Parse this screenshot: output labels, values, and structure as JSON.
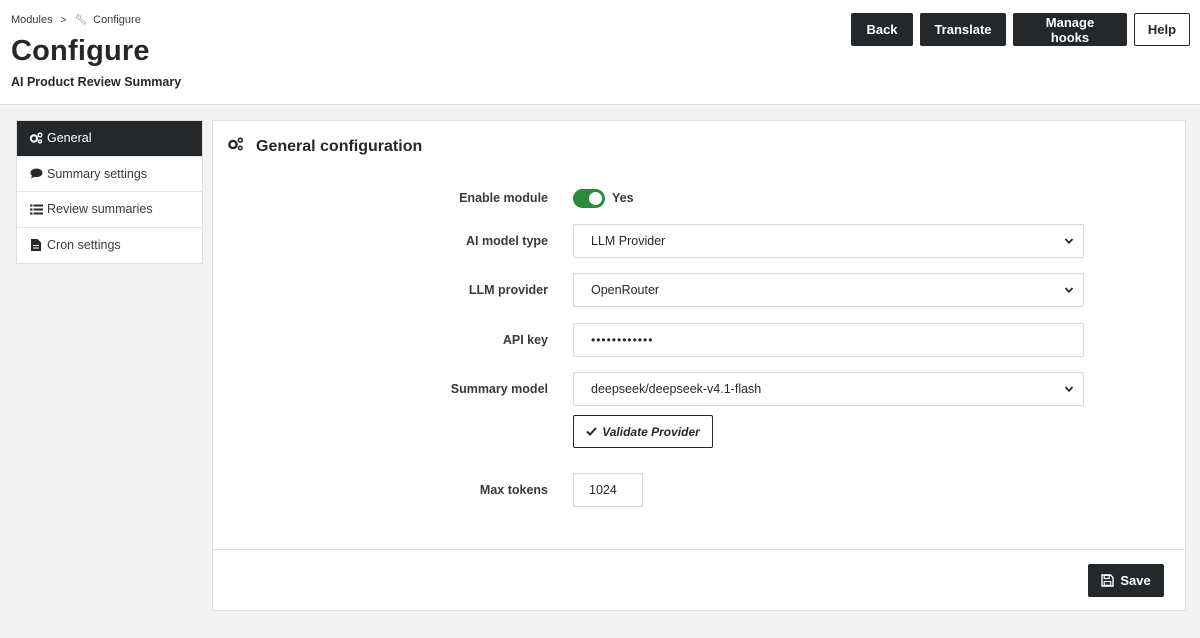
{
  "breadcrumb": {
    "parent": "Modules",
    "separator": ">",
    "current": "Configure"
  },
  "page": {
    "title": "Configure",
    "subtitle": "AI Product Review Summary"
  },
  "toolbar": {
    "back": "Back",
    "translate": "Translate",
    "manage_hooks": "Manage hooks",
    "help": "Help"
  },
  "sidebar": {
    "items": [
      {
        "label": "General",
        "icon": "gears-icon",
        "active": true
      },
      {
        "label": "Summary settings",
        "icon": "comment-icon",
        "active": false
      },
      {
        "label": "Review summaries",
        "icon": "list-icon",
        "active": false
      },
      {
        "label": "Cron settings",
        "icon": "file-icon",
        "active": false
      }
    ]
  },
  "panel": {
    "heading": "General configuration",
    "fields": {
      "enable_module": {
        "label": "Enable module",
        "value": "Yes",
        "enabled": true
      },
      "ai_model_type": {
        "label": "AI model type",
        "value": "LLM Provider"
      },
      "llm_provider": {
        "label": "LLM provider",
        "value": "OpenRouter"
      },
      "api_key": {
        "label": "API key",
        "value": "••••••••••••"
      },
      "summary_model": {
        "label": "Summary model",
        "value": "deepseek/deepseek-v4.1-flash"
      },
      "max_tokens": {
        "label": "Max tokens",
        "value": "1024"
      }
    },
    "validate_label": "Validate Provider",
    "save_label": "Save"
  },
  "colors": {
    "dark": "#25282b",
    "toggle_on": "#2b8a3e",
    "background": "#f3f3f3"
  }
}
